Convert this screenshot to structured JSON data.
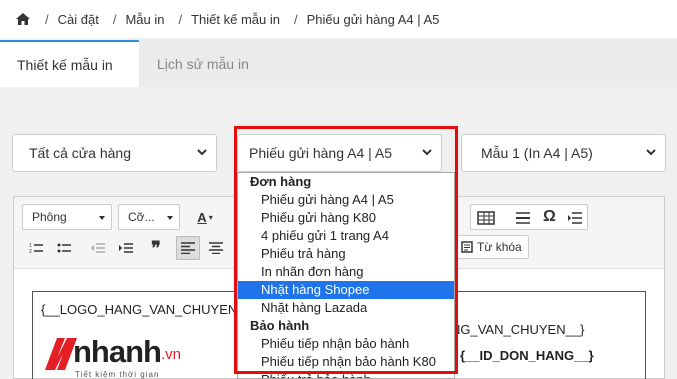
{
  "breadcrumb": {
    "items": [
      "Cài đặt",
      "Mẫu in",
      "Thiết kế mẫu in",
      "Phiếu gửi hàng A4 | A5"
    ],
    "separator": "/"
  },
  "tabs": [
    {
      "label": "Thiết kế mẫu in",
      "active": true
    },
    {
      "label": "Lịch sử mẫu in",
      "active": false
    }
  ],
  "filters": {
    "store": "Tất cả cửa hàng",
    "template": "Phiếu gửi hàng A4 | A5",
    "version": "Mẫu 1 (In A4 | A5)"
  },
  "dropdown": {
    "groups": [
      {
        "label": "Đơn hàng",
        "options": [
          "Phiếu gửi hàng A4 | A5",
          "Phiếu gửi hàng K80",
          "4 phiếu gửi 1 trang A4",
          "Phiếu trả hàng",
          "In nhãn đơn hàng",
          "Nhặt hàng Shopee",
          "Nhặt hàng Lazada"
        ]
      },
      {
        "label": "Bảo hành",
        "options": [
          "Phiếu tiếp nhận bảo hành",
          "Phiếu tiếp nhận bảo hành K80",
          "Phiếu trả bảo hành"
        ]
      }
    ],
    "highlighted": "Nhặt hàng Shopee"
  },
  "toolbar": {
    "paragraph": "Phông",
    "size": "Cỡ...",
    "font_color_label": "A",
    "omega": "Ω",
    "quote": "❞",
    "keyword_label": "Từ khóa"
  },
  "editor": {
    "logo_var": "{__LOGO_HANG_VAN_CHUYEN__}",
    "ship_var": "NG_VAN_CHUYEN__}",
    "order_var": "{__ID_DON_HANG__}",
    "logo_text": "nhanh",
    "logo_suffix": ".vn",
    "logo_tagline": "Tiết kiệm thời gian"
  },
  "colors": {
    "accent": "#2f8fd8",
    "highlight": "#1e74e8",
    "red_frame": "#e30d0d",
    "logo_red": "#e31e24"
  }
}
